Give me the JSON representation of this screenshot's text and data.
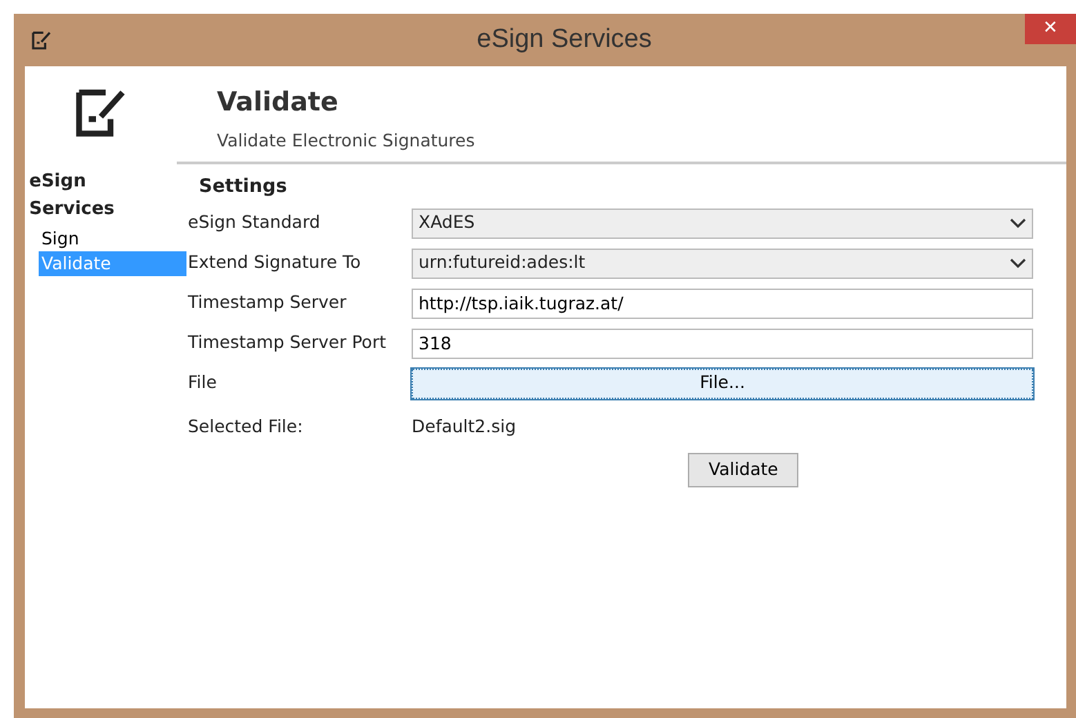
{
  "window": {
    "title": "eSign Services",
    "close": "✕"
  },
  "sidebar": {
    "title": "eSign Services",
    "items": [
      {
        "label": "Sign",
        "selected": false
      },
      {
        "label": "Validate",
        "selected": true
      }
    ]
  },
  "header": {
    "title": "Validate",
    "subtitle": "Validate Electronic Signatures"
  },
  "settings": {
    "title": "Settings",
    "rows": [
      {
        "kind": "select",
        "label": "eSign Standard",
        "value": "XAdES"
      },
      {
        "kind": "select",
        "label": "Extend Signature To",
        "value": "urn:futureid:ades:lt"
      },
      {
        "kind": "text",
        "label": "Timestamp Server",
        "value": "http://tsp.iaik.tugraz.at/"
      },
      {
        "kind": "text",
        "label": "Timestamp Server Port",
        "value": "318"
      },
      {
        "kind": "button",
        "label": "File",
        "value": "File..."
      },
      {
        "kind": "label",
        "label": "Selected File:",
        "value": "Default2.sig"
      }
    ]
  },
  "buttons": [
    "Validate"
  ]
}
